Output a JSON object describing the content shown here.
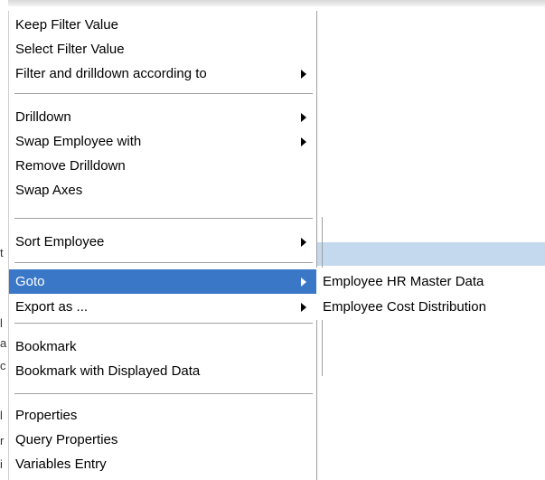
{
  "background": {
    "left_chars": [
      "t",
      "l",
      "a",
      "c",
      "l",
      "r",
      "i"
    ]
  },
  "menu": {
    "items": [
      {
        "label": "Keep Filter Value",
        "submenu": false
      },
      {
        "label": "Select Filter Value",
        "submenu": false
      },
      {
        "label": "Filter and drilldown according to",
        "submenu": true
      },
      {
        "label": "Drilldown",
        "submenu": true
      },
      {
        "label": "Swap Employee with",
        "submenu": true
      },
      {
        "label": "Remove Drilldown",
        "submenu": false
      },
      {
        "label": "Swap Axes",
        "submenu": false
      },
      {
        "label": "Sort Employee",
        "submenu": true
      },
      {
        "label": "Goto",
        "submenu": true,
        "active": true
      },
      {
        "label": "Export as ...",
        "submenu": true
      },
      {
        "label": "Bookmark",
        "submenu": false
      },
      {
        "label": "Bookmark with Displayed Data",
        "submenu": false
      },
      {
        "label": "Properties",
        "submenu": false
      },
      {
        "label": "Query Properties",
        "submenu": false
      },
      {
        "label": "Variables Entry",
        "submenu": false
      }
    ]
  },
  "submenu": {
    "items": [
      {
        "label": "Employee HR Master Data"
      },
      {
        "label": "Employee Cost Distribution"
      }
    ]
  },
  "colors": {
    "highlight": "#3a77c6",
    "header_band": "#c5d9ee"
  }
}
